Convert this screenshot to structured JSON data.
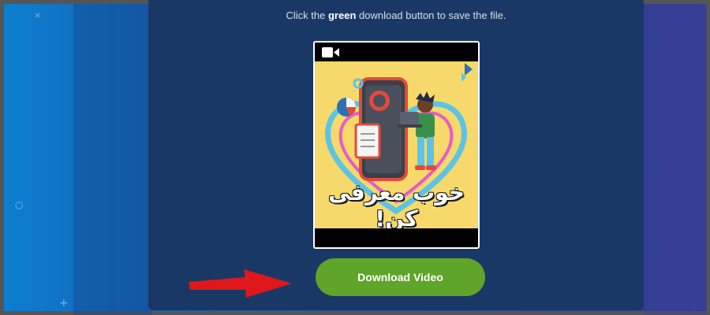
{
  "instruction": {
    "prefix": "Click the ",
    "emphasis": "green",
    "suffix": " download button to save the file."
  },
  "video": {
    "camera_icon": "video-camera-icon",
    "thumbnail_text": "خوب معرفی کن!"
  },
  "download_button": {
    "label": "Download Video",
    "color": "#5ea52a"
  },
  "decorations": {
    "x": "×",
    "circle": "○",
    "plus": "+"
  },
  "colors": {
    "panel": "#1a3866",
    "arrow": "#e0181b",
    "thumbnail_bg": "#f6d96a"
  }
}
